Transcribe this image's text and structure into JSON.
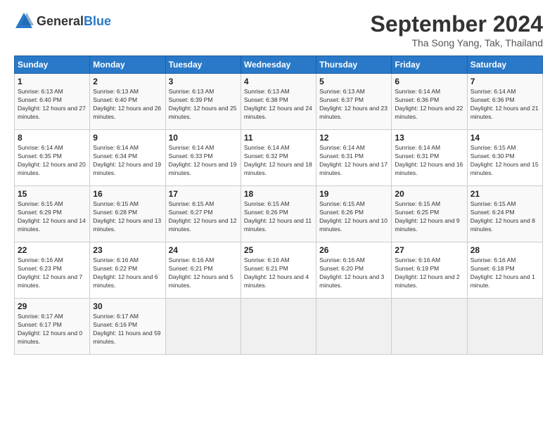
{
  "header": {
    "logo_general": "General",
    "logo_blue": "Blue",
    "month_title": "September 2024",
    "location": "Tha Song Yang, Tak, Thailand"
  },
  "weekdays": [
    "Sunday",
    "Monday",
    "Tuesday",
    "Wednesday",
    "Thursday",
    "Friday",
    "Saturday"
  ],
  "weeks": [
    [
      {
        "day": "1",
        "sunrise": "Sunrise: 6:13 AM",
        "sunset": "Sunset: 6:40 PM",
        "daylight": "Daylight: 12 hours and 27 minutes."
      },
      {
        "day": "2",
        "sunrise": "Sunrise: 6:13 AM",
        "sunset": "Sunset: 6:40 PM",
        "daylight": "Daylight: 12 hours and 26 minutes."
      },
      {
        "day": "3",
        "sunrise": "Sunrise: 6:13 AM",
        "sunset": "Sunset: 6:39 PM",
        "daylight": "Daylight: 12 hours and 25 minutes."
      },
      {
        "day": "4",
        "sunrise": "Sunrise: 6:13 AM",
        "sunset": "Sunset: 6:38 PM",
        "daylight": "Daylight: 12 hours and 24 minutes."
      },
      {
        "day": "5",
        "sunrise": "Sunrise: 6:13 AM",
        "sunset": "Sunset: 6:37 PM",
        "daylight": "Daylight: 12 hours and 23 minutes."
      },
      {
        "day": "6",
        "sunrise": "Sunrise: 6:14 AM",
        "sunset": "Sunset: 6:36 PM",
        "daylight": "Daylight: 12 hours and 22 minutes."
      },
      {
        "day": "7",
        "sunrise": "Sunrise: 6:14 AM",
        "sunset": "Sunset: 6:36 PM",
        "daylight": "Daylight: 12 hours and 21 minutes."
      }
    ],
    [
      {
        "day": "8",
        "sunrise": "Sunrise: 6:14 AM",
        "sunset": "Sunset: 6:35 PM",
        "daylight": "Daylight: 12 hours and 20 minutes."
      },
      {
        "day": "9",
        "sunrise": "Sunrise: 6:14 AM",
        "sunset": "Sunset: 6:34 PM",
        "daylight": "Daylight: 12 hours and 19 minutes."
      },
      {
        "day": "10",
        "sunrise": "Sunrise: 6:14 AM",
        "sunset": "Sunset: 6:33 PM",
        "daylight": "Daylight: 12 hours and 19 minutes."
      },
      {
        "day": "11",
        "sunrise": "Sunrise: 6:14 AM",
        "sunset": "Sunset: 6:32 PM",
        "daylight": "Daylight: 12 hours and 18 minutes."
      },
      {
        "day": "12",
        "sunrise": "Sunrise: 6:14 AM",
        "sunset": "Sunset: 6:31 PM",
        "daylight": "Daylight: 12 hours and 17 minutes."
      },
      {
        "day": "13",
        "sunrise": "Sunrise: 6:14 AM",
        "sunset": "Sunset: 6:31 PM",
        "daylight": "Daylight: 12 hours and 16 minutes."
      },
      {
        "day": "14",
        "sunrise": "Sunrise: 6:15 AM",
        "sunset": "Sunset: 6:30 PM",
        "daylight": "Daylight: 12 hours and 15 minutes."
      }
    ],
    [
      {
        "day": "15",
        "sunrise": "Sunrise: 6:15 AM",
        "sunset": "Sunset: 6:29 PM",
        "daylight": "Daylight: 12 hours and 14 minutes."
      },
      {
        "day": "16",
        "sunrise": "Sunrise: 6:15 AM",
        "sunset": "Sunset: 6:28 PM",
        "daylight": "Daylight: 12 hours and 13 minutes."
      },
      {
        "day": "17",
        "sunrise": "Sunrise: 6:15 AM",
        "sunset": "Sunset: 6:27 PM",
        "daylight": "Daylight: 12 hours and 12 minutes."
      },
      {
        "day": "18",
        "sunrise": "Sunrise: 6:15 AM",
        "sunset": "Sunset: 6:26 PM",
        "daylight": "Daylight: 12 hours and 11 minutes."
      },
      {
        "day": "19",
        "sunrise": "Sunrise: 6:15 AM",
        "sunset": "Sunset: 6:26 PM",
        "daylight": "Daylight: 12 hours and 10 minutes."
      },
      {
        "day": "20",
        "sunrise": "Sunrise: 6:15 AM",
        "sunset": "Sunset: 6:25 PM",
        "daylight": "Daylight: 12 hours and 9 minutes."
      },
      {
        "day": "21",
        "sunrise": "Sunrise: 6:15 AM",
        "sunset": "Sunset: 6:24 PM",
        "daylight": "Daylight: 12 hours and 8 minutes."
      }
    ],
    [
      {
        "day": "22",
        "sunrise": "Sunrise: 6:16 AM",
        "sunset": "Sunset: 6:23 PM",
        "daylight": "Daylight: 12 hours and 7 minutes."
      },
      {
        "day": "23",
        "sunrise": "Sunrise: 6:16 AM",
        "sunset": "Sunset: 6:22 PM",
        "daylight": "Daylight: 12 hours and 6 minutes."
      },
      {
        "day": "24",
        "sunrise": "Sunrise: 6:16 AM",
        "sunset": "Sunset: 6:21 PM",
        "daylight": "Daylight: 12 hours and 5 minutes."
      },
      {
        "day": "25",
        "sunrise": "Sunrise: 6:16 AM",
        "sunset": "Sunset: 6:21 PM",
        "daylight": "Daylight: 12 hours and 4 minutes."
      },
      {
        "day": "26",
        "sunrise": "Sunrise: 6:16 AM",
        "sunset": "Sunset: 6:20 PM",
        "daylight": "Daylight: 12 hours and 3 minutes."
      },
      {
        "day": "27",
        "sunrise": "Sunrise: 6:16 AM",
        "sunset": "Sunset: 6:19 PM",
        "daylight": "Daylight: 12 hours and 2 minutes."
      },
      {
        "day": "28",
        "sunrise": "Sunrise: 6:16 AM",
        "sunset": "Sunset: 6:18 PM",
        "daylight": "Daylight: 12 hours and 1 minute."
      }
    ],
    [
      {
        "day": "29",
        "sunrise": "Sunrise: 6:17 AM",
        "sunset": "Sunset: 6:17 PM",
        "daylight": "Daylight: 12 hours and 0 minutes."
      },
      {
        "day": "30",
        "sunrise": "Sunrise: 6:17 AM",
        "sunset": "Sunset: 6:16 PM",
        "daylight": "Daylight: 11 hours and 59 minutes."
      },
      null,
      null,
      null,
      null,
      null
    ]
  ]
}
